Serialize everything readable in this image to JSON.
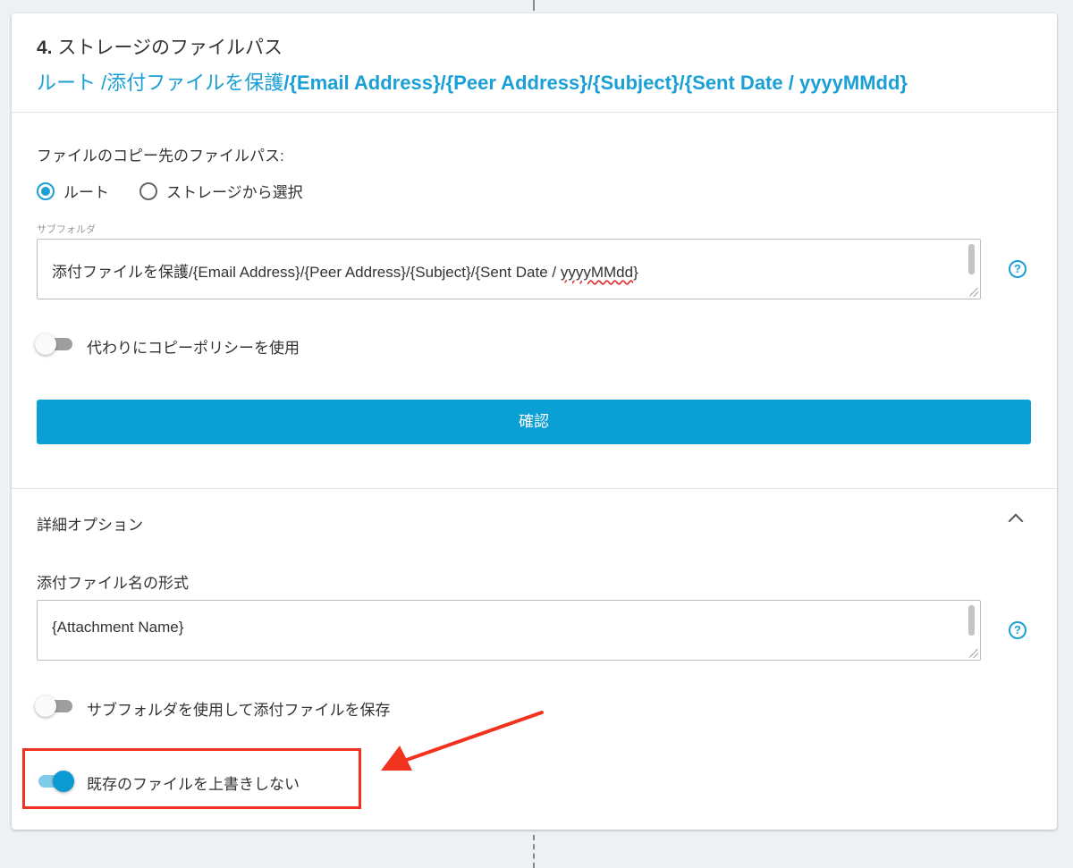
{
  "header": {
    "step": "4.",
    "title": "ストレージのファイルパス",
    "path_root": "ルート",
    "path_rest": " /添付ファイルを保護",
    "path_vars": "/{Email Address}/{Peer Address}/{Subject}/{Sent Date / yyyyMMdd}"
  },
  "copy_dest": {
    "label": "ファイルのコピー先のファイルパス:",
    "radio_root": "ルート",
    "radio_storage": "ストレージから選択",
    "subfolder_label": "サブフォルダ",
    "subfolder_value_main": "添付ファイルを保護/{Email Address}/{Peer Address}/{Subject}/{Sent Date / ",
    "subfolder_value_tail": "yyyyMMdd",
    "subfolder_value_end": "}",
    "help": "?",
    "use_copy_policy": "代わりにコピーポリシーを使用",
    "confirm": "確認"
  },
  "advanced": {
    "title": "詳細オプション",
    "filename_label": "添付ファイル名の形式",
    "filename_value": "{Attachment Name}",
    "help": "?",
    "use_subfolder": "サブフォルダを使用して添付ファイルを保存",
    "no_overwrite": "既存のファイルを上書きしない"
  },
  "colors": {
    "accent": "#0a9fd5",
    "annotation": "#f0321e"
  }
}
